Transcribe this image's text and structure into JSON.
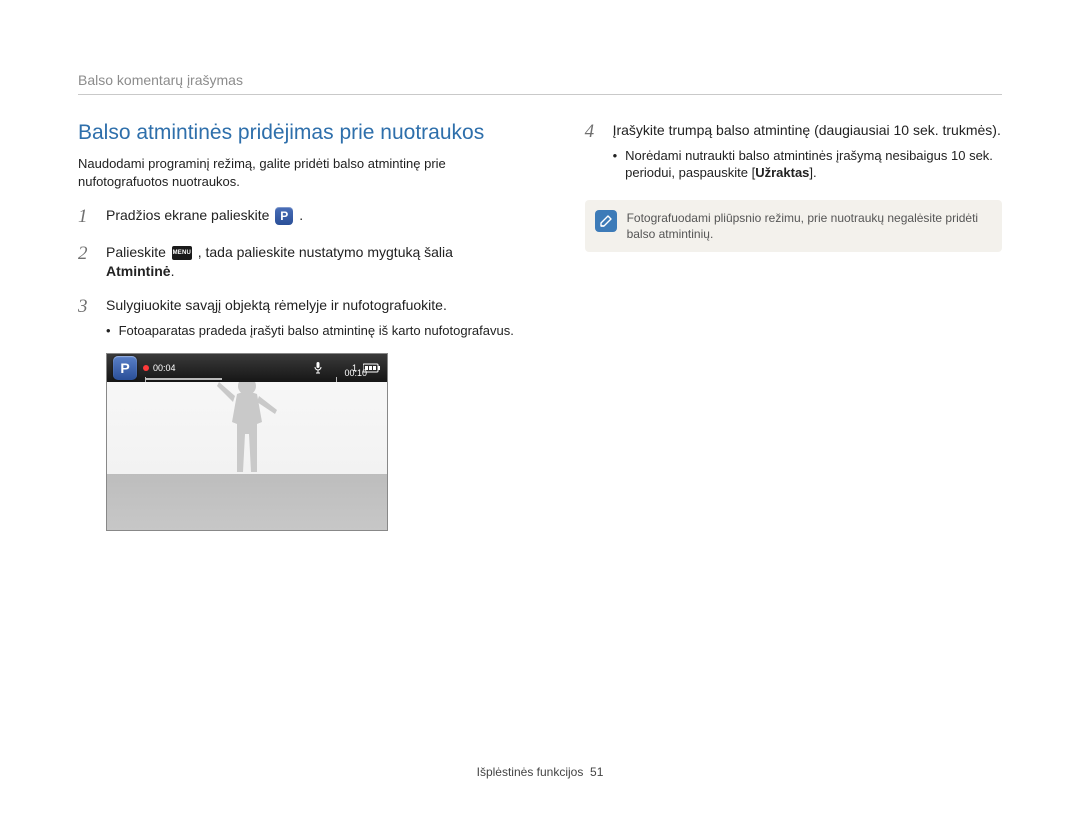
{
  "running_head": "Balso komentarų įrašymas",
  "section_title": "Balso atmintinės pridėjimas prie nuotraukos",
  "intro": "Naudodami programinį režimą, galite pridėti balso atmintinę prie nufotografuotos nuotraukos.",
  "steps": {
    "1": {
      "num": "1",
      "text_before": "Pradžios ekrane palieskite ",
      "text_after": "."
    },
    "2": {
      "num": "2",
      "text_before": "Palieskite ",
      "text_mid": ", tada palieskite nustatymo mygtuką šalia ",
      "bold": "Atmintinė",
      "text_after": "."
    },
    "3": {
      "num": "3",
      "text": "Sulygiuokite savąjį objektą rėmelyje ir nufotografuokite.",
      "bullet": "Fotoaparatas pradeda įrašyti balso atmintinę iš karto nufotografavus."
    },
    "4": {
      "num": "4",
      "text": "Įrašykite trumpą balso atmintinę (daugiausiai 10 sek. trukmės).",
      "bullet_before": "Norėdami nutraukti balso atmintinės įrašymą nesibaigus 10 sek. periodui, paspauskite [",
      "bullet_bold": "Užraktas",
      "bullet_after": "]."
    }
  },
  "preview": {
    "p_label": "P",
    "time_elapsed": "00:04",
    "time_total": "00:10",
    "counter": "1"
  },
  "icons": {
    "p_badge": "P",
    "menu_label": "MENU"
  },
  "note": "Fotografuodami pliūpsnio režimu, prie nuotraukų negalėsite pridėti balso atmintinių.",
  "footer": {
    "label": "Išplėstinės funkcijos",
    "page": "51"
  }
}
